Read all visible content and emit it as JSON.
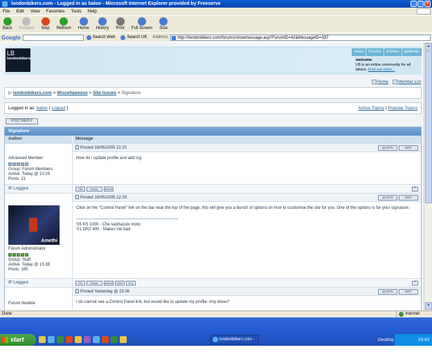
{
  "window": {
    "title": "londonbikers.com - Logged in as baloo - Microsoft Internet Explorer provided by Freeserve",
    "minimize": "_",
    "maximize": "□",
    "close": "×"
  },
  "menu": [
    "File",
    "Edit",
    "View",
    "Favorites",
    "Tools",
    "Help"
  ],
  "toolbar": [
    {
      "label": "Back",
      "color": "#2f9e2f"
    },
    {
      "label": "Forward",
      "color": "#bbbbbb"
    },
    {
      "label": "Stop",
      "color": "#d9471f"
    },
    {
      "label": "Refresh",
      "color": "#2f9e2f"
    },
    {
      "label": "Home",
      "color": "#4a7bd4"
    },
    {
      "label": "History",
      "color": "#4a7bd4"
    },
    {
      "label": "Print",
      "color": "#777777"
    },
    {
      "label": "Full Screen",
      "color": "#4a7bd4"
    },
    {
      "label": "Size",
      "color": "#4a7bd4"
    }
  ],
  "googlebar": {
    "logo": "Google",
    "search_web": "Search Web",
    "search_uk": "Search UK",
    "address_label": "Address",
    "url": "http://londonbikers.com/forums/showmessage.asp?ForumID=42&MessageID=337"
  },
  "site": {
    "logo_big": "LB",
    "logo_small": "londonbikers",
    "nav": [
      "news",
      "forums",
      "articles",
      "galleries"
    ],
    "welcome_title": "welcome",
    "welcome_text": "LB is an online community for all bikers.",
    "find_out_more": "Find out more...",
    "home_link": "Home",
    "member_list_link": "Member List"
  },
  "breadcrumb": {
    "home": "londonbikers.com",
    "cat": "Miscellaneous",
    "forum": "Site Issues",
    "current": "Signature"
  },
  "logged": {
    "prefix": "Logged in as:",
    "user": "baloo",
    "logout": "Logout",
    "active_topics": "Active Topics",
    "popular_topics": "Popular Topics"
  },
  "post_reply_btn": "POST REPLY",
  "table": {
    "title": "Signature",
    "col_author": "Author",
    "col_message": "Message",
    "ip_logged": "IP Logged",
    "quote": "QUOTE",
    "edit": "EDIT"
  },
  "posts": [
    {
      "posted": "Posted 18/05/2005 22:25",
      "author_rank": "Advanced Member",
      "group": "Group: Forum Members",
      "active": "Active: Today @ 10:29",
      "posts": "Posts: 21",
      "message": "How do i update profile and add sig",
      "buttons": [
        "PM",
        "EMAIL",
        "WWW"
      ]
    },
    {
      "posted": "Posted 18/05/2005 22:29",
      "avatar_caption": "Amethi",
      "author_rank": "Forum Administrator",
      "group": "Group: Staff",
      "active": "Active: Today @ 15:38",
      "posts": "Posts: 165",
      "message": "Click on the \"Control Panel\" link on the bar near the top of the page, this will give you a bunch of options on how to customise the site for you. One of the options is for your signature.",
      "sig1": "'05 KS 1000 - Che septtaculo moto",
      "sig2": "'01 DRZ 400 - Makes me bad",
      "buttons": [
        "PM",
        "EMAIL",
        "WWW",
        "MSN",
        "ICQ"
      ]
    },
    {
      "posted": "Posted Yesterday @ 15:06",
      "author_rank": "Forum Newbie",
      "message": "I do cannot see a Control Panel link, but would like to update my profile. Any ideas?"
    }
  ],
  "status": {
    "text": "Done",
    "zone": "Internet"
  },
  "taskbar": {
    "start": "start",
    "task": "londonbikers.com - Lo...",
    "desktop": "Desktop",
    "clock": "16:43"
  }
}
